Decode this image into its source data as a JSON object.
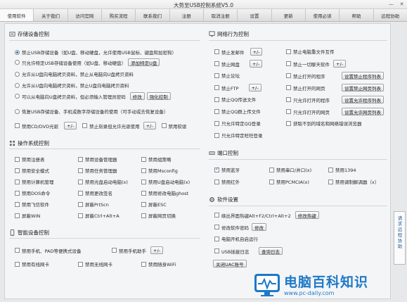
{
  "window": {
    "title": "大势至USB控制系统V5.0",
    "min": "—",
    "close": "✕"
  },
  "tabs": [
    "使用软件",
    "关于我们",
    "访问官网",
    "购买流程",
    "联系我们",
    "注册",
    "取消注册",
    "设置",
    "更新",
    "使用必读",
    "帮助",
    "远程协助"
  ],
  "storage": {
    "title": "存储设备控制",
    "options": [
      "禁止USB存储设备（如U盘、移动硬盘，允许使用USB鼠标、键盘和加密狗）",
      "只允许特定USB存储设备使用（如U盘、移动硬盘）",
      "允许从U盘向电脑拷贝资料，禁止从电脑向U盘拷贝资料",
      "允许从U盘向电脑拷贝资料，禁止U盘向电脑拷贝资料",
      "可以从电脑向U盘拷贝资料，但必须输入管理员密码",
      "恢复USB存储设备、手机或数字存储设备的使用（可手动或去恢复设备）"
    ],
    "add_btn": "添加特定U盘",
    "modify_btn": "修改",
    "force_btn": "强化控制",
    "cd_label": "禁用CD/DVD光驱",
    "cd_btn": "+/-",
    "burn_label": "禁止刻录但允许光驱使用",
    "burn_btn": "+/-",
    "floppy_label": "禁用软驱"
  },
  "os": {
    "title": "操作系统控制",
    "items": [
      [
        "禁用注册表",
        "禁用设备管理器",
        "禁用组策略"
      ],
      [
        "禁用安全模式",
        "禁用任务管理器",
        "禁用Msconfig"
      ],
      [
        "禁用计算机管理",
        "禁用光盘启动电脑(x)",
        "禁用U盘启动电脑(x)"
      ],
      [
        "禁用DOS命令",
        "禁用更改签名",
        "禁用修改电脑ghost"
      ],
      [
        "禁用飞信软件",
        "屏蔽PrtScn",
        "屏蔽ESC"
      ],
      [
        "屏蔽WIN",
        "屏蔽Ctrl+Alt+A",
        "屏蔽网页切换"
      ]
    ]
  },
  "smart": {
    "title": "智能设备控制",
    "phone_label": "禁用手机、PAD等便携式设备",
    "assistant_label": "禁用手机助手",
    "assistant_btn": "+/-",
    "items": [
      "禁用有线网卡",
      "禁用无线网卡",
      "禁用随身WiFi"
    ]
  },
  "network": {
    "title": "网络行为控制",
    "left_items": [
      {
        "label": "禁止发邮件",
        "btn": "+/-"
      },
      {
        "label": "禁止网盘",
        "btn": "+/-"
      },
      {
        "label": "禁止论坛",
        "btn": ""
      },
      {
        "label": "禁止FTP",
        "btn": "+/-"
      },
      {
        "label": "禁止QQ传送文件",
        "btn": ""
      },
      {
        "label": "禁止QQ群上传文件",
        "btn": ""
      },
      {
        "label": "只允许特定QQ登录",
        "btn": ""
      },
      {
        "label": "只允许特定旺旺登录",
        "btn": ""
      }
    ],
    "right_items": [
      {
        "label": "禁止电脑重文件互传",
        "btn": ""
      },
      {
        "label": "禁止一切聊天软件",
        "btn": "+/-"
      },
      {
        "label": "禁止打开的程序",
        "btn": "设置禁止程序列表"
      },
      {
        "label": "禁止打开的网页",
        "btn": "设置禁止网页列表"
      },
      {
        "label": "只允许打开的程序",
        "btn": "设置允许程序列表"
      },
      {
        "label": "只允许打开的网页",
        "btn": "设置允许网页列表"
      },
      {
        "label": "获取不到的域名和网络错误浏览器",
        "btn": ""
      }
    ]
  },
  "ports": {
    "title": "端口控制",
    "items": [
      [
        "禁用蓝牙",
        "禁用串口/并口(x)",
        "禁用1394"
      ],
      [
        "禁用红外",
        "禁用PCMCIA(x)",
        "禁用调制解调器（x）"
      ]
    ]
  },
  "software": {
    "title": "软件设置",
    "hotkey_label": "唤出界面热键Alt+F2/Ctrl+Alt+2",
    "hotkey_btn": "修改热键",
    "pwd_label": "修改软件密码",
    "pwd_btn": "修改",
    "autostart_label": "电脑开机自启运行",
    "log_label": "USB插拔日志",
    "log_btn": "查询日志",
    "uac_btn": "关闭UAC账号"
  },
  "sidestrip": {
    "text": "请求远程协助"
  },
  "watermark": {
    "main": "电脑百科知识",
    "sub": "www.pc-daily.com"
  }
}
